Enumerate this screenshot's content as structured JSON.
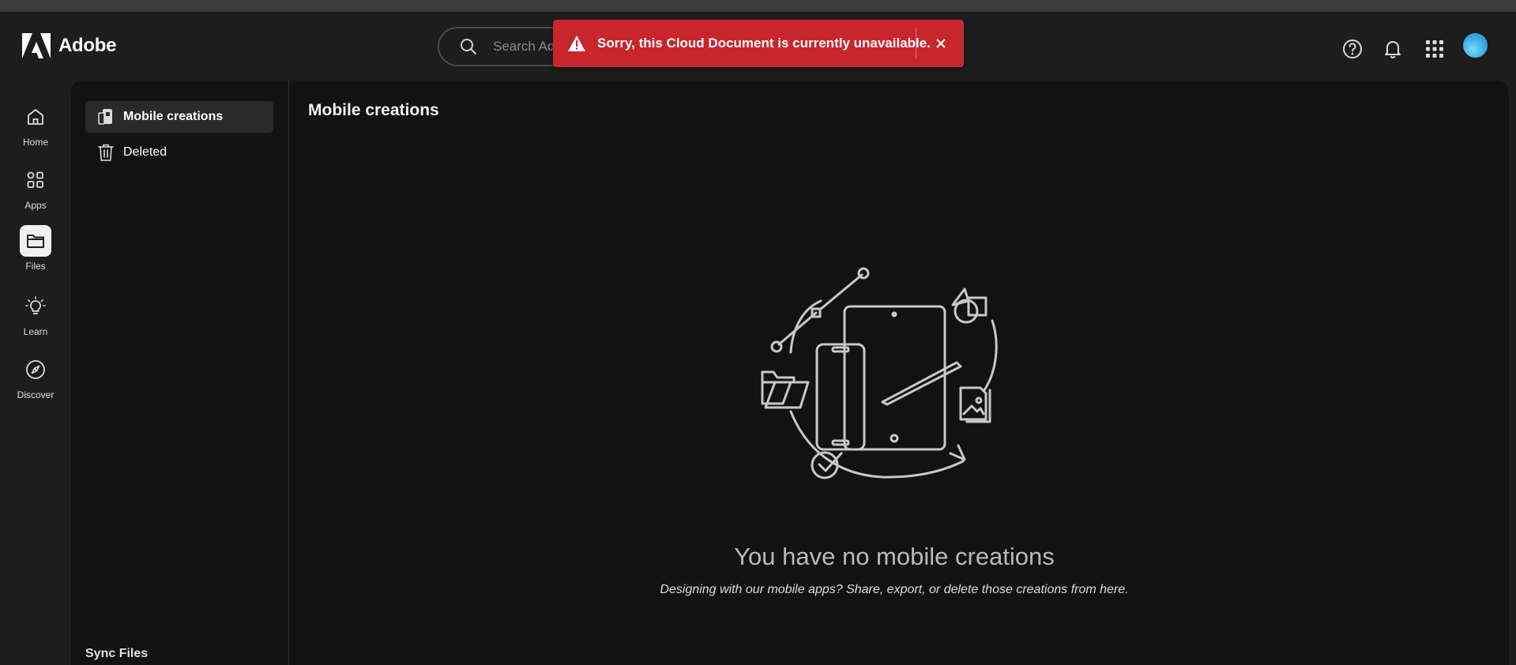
{
  "app": {
    "brand": "Adobe"
  },
  "search": {
    "placeholder": "Search Adobe"
  },
  "toast": {
    "message": "Sorry, this Cloud Document is currently unavailable.",
    "color": "#c9252d"
  },
  "header_icons": [
    "help-icon",
    "bell-icon",
    "apps-grid-icon",
    "avatar"
  ],
  "left_nav": {
    "items": [
      {
        "label": "Home",
        "icon": "home-icon"
      },
      {
        "label": "Apps",
        "icon": "apps-icon"
      },
      {
        "label": "Files",
        "icon": "folder-icon",
        "active": true
      },
      {
        "label": "Learn",
        "icon": "lightbulb-icon"
      },
      {
        "label": "Discover",
        "icon": "compass-icon"
      }
    ]
  },
  "sub_nav": {
    "items": [
      {
        "label": "Mobile creations",
        "icon": "mobile-creations-icon",
        "active": true
      },
      {
        "label": "Deleted",
        "icon": "trash-icon"
      }
    ],
    "section_partial": "Sync Files"
  },
  "main": {
    "title": "Mobile creations",
    "empty_title": "You have no mobile creations",
    "empty_subtitle": "Designing with our mobile apps? Share, export, or delete those creations from here."
  }
}
